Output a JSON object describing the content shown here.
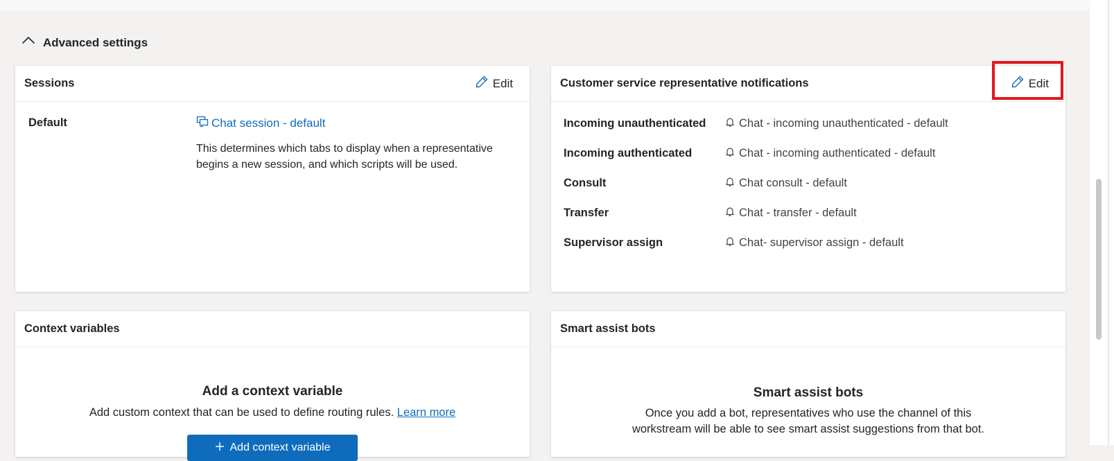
{
  "advanced_settings": {
    "toggle_icon": "chevron-up-icon",
    "title": "Advanced settings"
  },
  "sessions": {
    "title": "Sessions",
    "edit_label": "Edit",
    "default_label": "Default",
    "link_label": "Chat session - default",
    "link_icon": "session-icon",
    "description": "This determines which tabs to display when a representative begins a new session, and which scripts will be used."
  },
  "notifications": {
    "title": "Customer service representative notifications",
    "edit_label": "Edit",
    "rows": [
      {
        "label": "Incoming unauthenticated",
        "value": "Chat - incoming unauthenticated - default"
      },
      {
        "label": "Incoming authenticated",
        "value": "Chat - incoming authenticated - default"
      },
      {
        "label": "Consult",
        "value": "Chat consult - default"
      },
      {
        "label": "Transfer",
        "value": "Chat - transfer - default"
      },
      {
        "label": "Supervisor assign",
        "value": "Chat- supervisor assign - default"
      }
    ],
    "row_icon": "bell-icon"
  },
  "context_variables": {
    "title": "Context variables",
    "empty_title": "Add a context variable",
    "empty_desc": "Add custom context that can be used to define routing rules.",
    "learn_more": "Learn more",
    "add_button_label": "Add context variable"
  },
  "smart_assist": {
    "title": "Smart assist bots",
    "empty_title": "Smart assist bots",
    "empty_desc": "Once you add a bot, representatives who use the channel of this workstream will be able to see smart assist suggestions from that bot."
  },
  "colors": {
    "accent": "#0f6cbd",
    "highlight": "#e0191f",
    "background": "#f3f2f1"
  }
}
